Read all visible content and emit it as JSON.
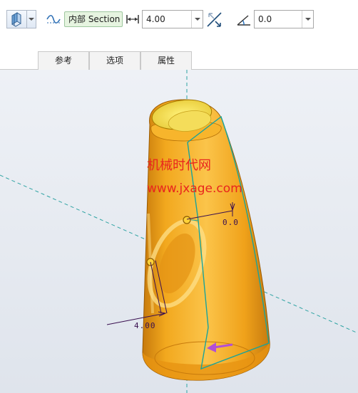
{
  "toolbar": {
    "section_label": "内部 Section",
    "offset_value": "4.00",
    "angle_value": "0.0"
  },
  "tabs": [
    {
      "label": "参考"
    },
    {
      "label": "选项"
    },
    {
      "label": "属性"
    }
  ],
  "viewport": {
    "dim_top": "0.0",
    "dim_left": "4.00",
    "watermark_cn": "机械时代网",
    "watermark_url": "www.jxage.com"
  },
  "colors": {
    "model_fill": "#f4b02a",
    "model_edge": "#1aa39a",
    "watermark": "#e8251e",
    "axis": "#2fa3a3",
    "direction_arrow": "#b24fd6"
  }
}
